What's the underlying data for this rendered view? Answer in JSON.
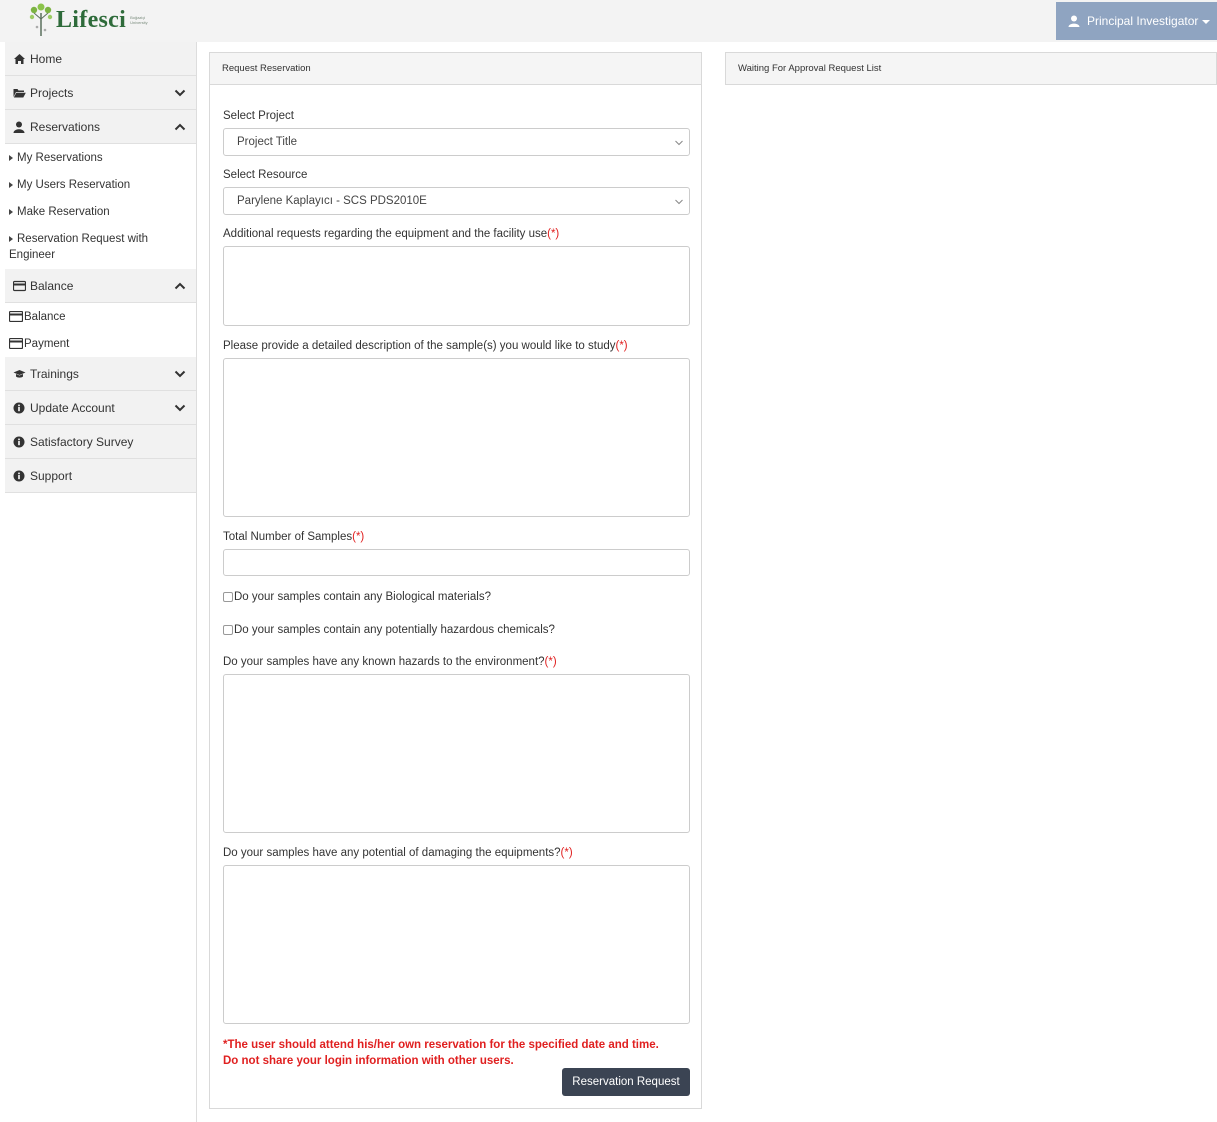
{
  "brand": {
    "name": "Lifesci",
    "subtext": "Boğaziçi University"
  },
  "user_menu": {
    "label": "Principal Investigator"
  },
  "sidebar": {
    "home": "Home",
    "projects": "Projects",
    "reservations": "Reservations",
    "reservations_items": [
      "My Reservations",
      "My Users Reservation",
      "Make Reservation",
      "Reservation Request with Engineer"
    ],
    "balance": "Balance",
    "balance_items": [
      "Balance",
      "Payment"
    ],
    "trainings": "Trainings",
    "update_account": "Update Account",
    "survey": "Satisfactory Survey",
    "support": "Support"
  },
  "form": {
    "panel_title": "Request Reservation",
    "project_label": "Select Project",
    "project_value": "Project Title",
    "resource_label": "Select Resource",
    "resource_value": "Parylene Kaplayıcı - SCS PDS2010E",
    "additional_label": "Additional requests regarding the equipment and the facility use",
    "description_label": "Please provide a detailed description of the sample(s) you would like to study",
    "samples_label": "Total Number of Samples",
    "bio_label": "Do your samples contain any Biological materials?",
    "chem_label": "Do your samples contain any potentially hazardous chemicals?",
    "env_label": "Do your samples have any known hazards to the environment?",
    "damage_label": "Do your samples have any potential of damaging the equipments?",
    "required_mark": "(*)",
    "warning_line1": "*The user should attend his/her own reservation for the specified date and time.",
    "warning_line2": "Do not share your login information with other users.",
    "submit_label": "Reservation Request"
  },
  "approval": {
    "panel_title": "Waiting For Approval Request List"
  }
}
